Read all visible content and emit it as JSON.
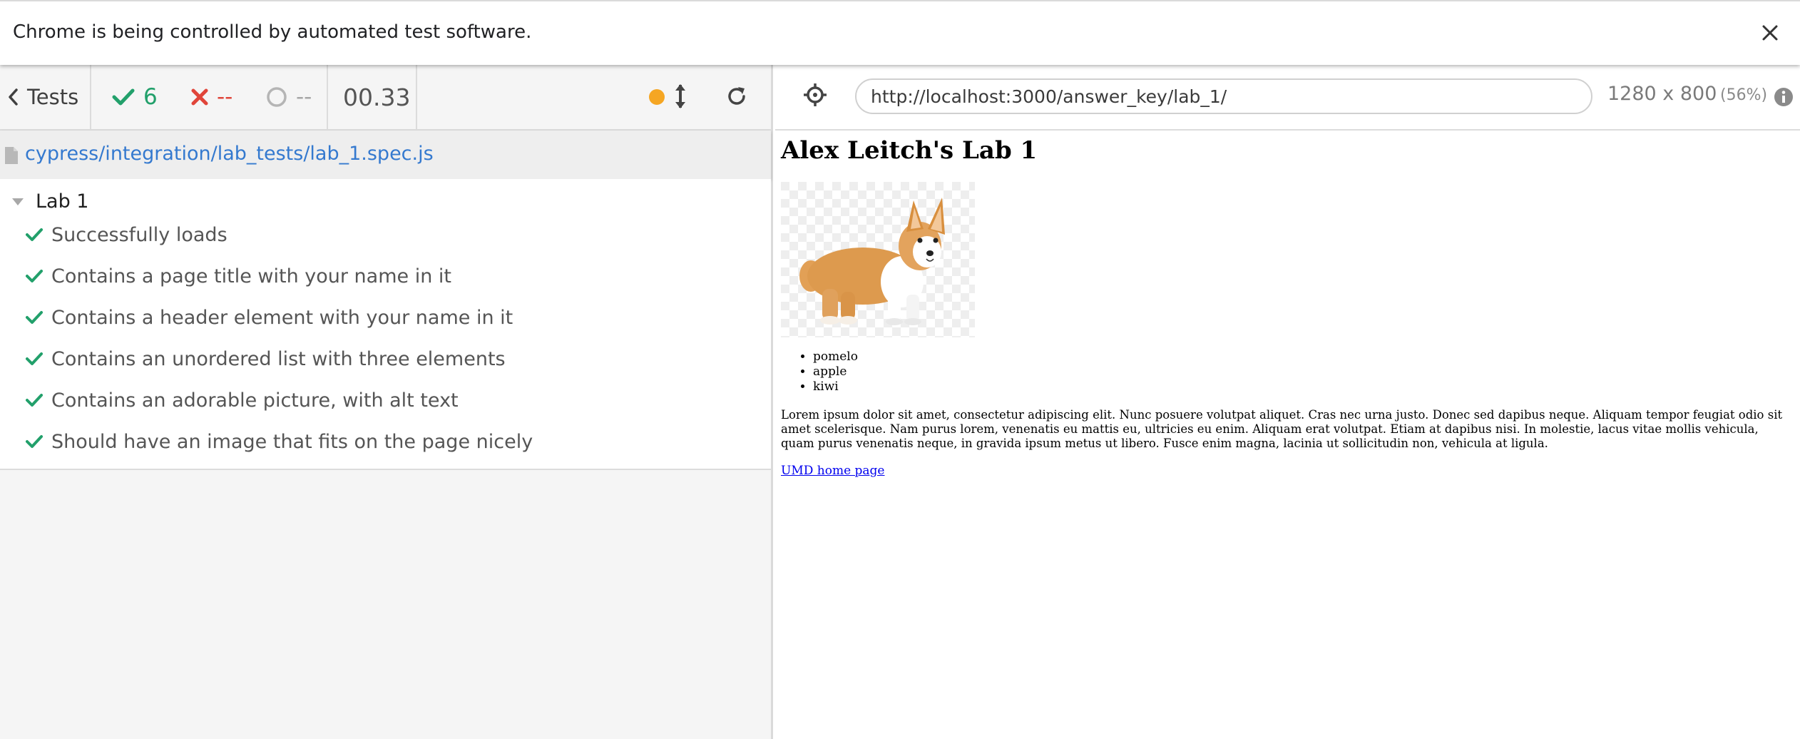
{
  "infobar": {
    "message": "Chrome is being controlled by automated test software.",
    "close_icon": "close-icon"
  },
  "reporter": {
    "tests_label": "Tests",
    "passed_count": "6",
    "failed_count": "--",
    "pending_count": "--",
    "duration": "00.33",
    "status_color": "#f5a623",
    "spec_path": "cypress/integration/lab_tests/lab_1.spec.js",
    "suite_title": "Lab 1",
    "tests": [
      {
        "label": "Successfully loads",
        "state": "passed"
      },
      {
        "label": "Contains a page title with your name in it",
        "state": "passed"
      },
      {
        "label": "Contains a header element with your name in it",
        "state": "passed"
      },
      {
        "label": "Contains an unordered list with three elements",
        "state": "passed"
      },
      {
        "label": "Contains an adorable picture, with alt text",
        "state": "passed"
      },
      {
        "label": "Should have an image that fits on the page nicely",
        "state": "passed"
      }
    ],
    "colors": {
      "passed": "#22a06b",
      "failed": "#e0453a",
      "pending": "#a6a6a6",
      "link": "#3479cf"
    }
  },
  "aut_header": {
    "url": "http://localhost:3000/answer_key/lab_1/",
    "viewport_size": "1280 x 800",
    "viewport_scale": "(56%)"
  },
  "aut_page": {
    "heading": "Alex Leitch's Lab 1",
    "image": "corgi-photo",
    "list_items": [
      "pomelo",
      "apple",
      "kiwi"
    ],
    "paragraph": "Lorem ipsum dolor sit amet, consectetur adipiscing elit. Nunc posuere volutpat aliquet. Cras nec urna justo. Donec sed dapibus neque. Aliquam tempor feugiat odio sit amet scelerisque. Nam purus lorem, venenatis eu mattis eu, ultricies eu enim. Aliquam erat volutpat. Etiam at dapibus nisi. In molestie, lacus vitae mollis vehicula, quam purus venenatis neque, in gravida ipsum metus ut libero. Fusce enim magna, lacinia ut sollicitudin non, vehicula at ligula.",
    "link_text": "UMD home page"
  }
}
